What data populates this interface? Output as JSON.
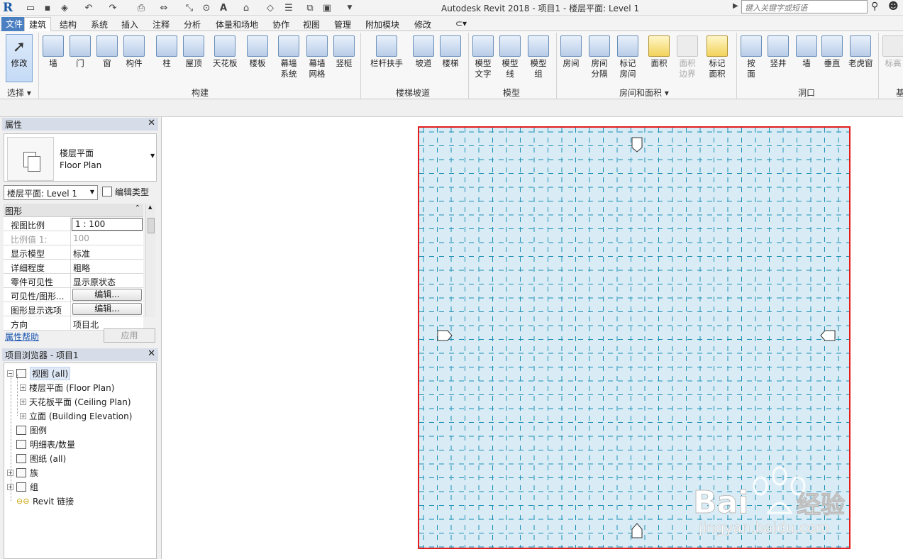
{
  "titlebar": {
    "title": "Autodesk Revit 2018 -     项目1 - 楼层平面: Level 1",
    "search_placeholder": "键入关键字或短语"
  },
  "tabs": [
    "文件",
    "建筑",
    "结构",
    "系统",
    "插入",
    "注释",
    "分析",
    "体量和场地",
    "协作",
    "视图",
    "管理",
    "附加模块",
    "修改"
  ],
  "active_tab": "建筑",
  "ribbon": {
    "modify": "修改",
    "select_panel": "选择",
    "build_panel": "构建",
    "stairs_panel": "楼梯坡道",
    "model_panel": "模型",
    "room_panel": "房间和面积",
    "opening_panel": "洞口",
    "base_panel": "基",
    "build": [
      {
        "l1": "墙",
        "l2": ""
      },
      {
        "l1": "门",
        "l2": ""
      },
      {
        "l1": "窗",
        "l2": ""
      },
      {
        "l1": "构件",
        "l2": ""
      },
      {
        "l1": "柱",
        "l2": ""
      },
      {
        "l1": "屋顶",
        "l2": ""
      },
      {
        "l1": "天花板",
        "l2": ""
      },
      {
        "l1": "楼板",
        "l2": ""
      },
      {
        "l1": "幕墙",
        "l2": "系统"
      },
      {
        "l1": "幕墙",
        "l2": "网格"
      },
      {
        "l1": "竖梃",
        "l2": ""
      }
    ],
    "stairs": [
      {
        "l1": "栏杆扶手",
        "l2": ""
      },
      {
        "l1": "坡道",
        "l2": ""
      },
      {
        "l1": "楼梯",
        "l2": ""
      }
    ],
    "model": [
      {
        "l1": "模型",
        "l2": "文字"
      },
      {
        "l1": "模型",
        "l2": "线"
      },
      {
        "l1": "模型",
        "l2": "组"
      }
    ],
    "room": [
      {
        "l1": "房间",
        "l2": ""
      },
      {
        "l1": "房间",
        "l2": "分隔"
      },
      {
        "l1": "标记",
        "l2": "房间"
      },
      {
        "l1": "面积",
        "l2": ""
      },
      {
        "l1": "面积",
        "l2": "边界"
      },
      {
        "l1": "标记",
        "l2": "面积"
      }
    ],
    "opening": [
      {
        "l1": "按",
        "l2": "面"
      },
      {
        "l1": "竖井",
        "l2": ""
      },
      {
        "l1": "墙",
        "l2": ""
      },
      {
        "l1": "垂直",
        "l2": ""
      },
      {
        "l1": "老虎窗",
        "l2": ""
      }
    ],
    "base": [
      {
        "l1": "标高",
        "l2": ""
      }
    ]
  },
  "properties": {
    "header": "属性",
    "type_name_cn": "楼层平面",
    "type_name_en": "Floor Plan",
    "type_selector": "楼层平面: Level 1",
    "edit_type": "编辑类型",
    "group": "图形",
    "rows": [
      {
        "k": "视图比例",
        "v": "1 : 100"
      },
      {
        "k": "比例值 1:",
        "v": "100"
      },
      {
        "k": "显示模型",
        "v": "标准"
      },
      {
        "k": "详细程度",
        "v": "粗略"
      },
      {
        "k": "零件可见性",
        "v": "显示原状态"
      },
      {
        "k": "可见性/图形...",
        "v": "编辑..."
      },
      {
        "k": "图形显示选项",
        "v": "编辑..."
      },
      {
        "k": "方向",
        "v": "项目北"
      }
    ],
    "help": "属性帮助",
    "apply": "应用"
  },
  "browser": {
    "header": "项目浏览器 - 项目1",
    "nodes": [
      {
        "label": "视图 (all)"
      },
      {
        "label": "楼层平面 (Floor Plan)"
      },
      {
        "label": "天花板平面 (Ceiling Plan)"
      },
      {
        "label": "立面 (Building Elevation)"
      },
      {
        "label": "图例"
      },
      {
        "label": "明细表/数量"
      },
      {
        "label": "图纸 (all)"
      },
      {
        "label": "族"
      },
      {
        "label": "组"
      },
      {
        "label": "Revit 链接"
      }
    ]
  },
  "watermark": {
    "brand": "Bai",
    "brand_cn": "经验",
    "url": "jingyan.baidu.com"
  },
  "colors": {
    "crop_border": "#e31c1c",
    "plan_fill": "#d9ecf6",
    "grid_line": "#1b8fb5"
  }
}
